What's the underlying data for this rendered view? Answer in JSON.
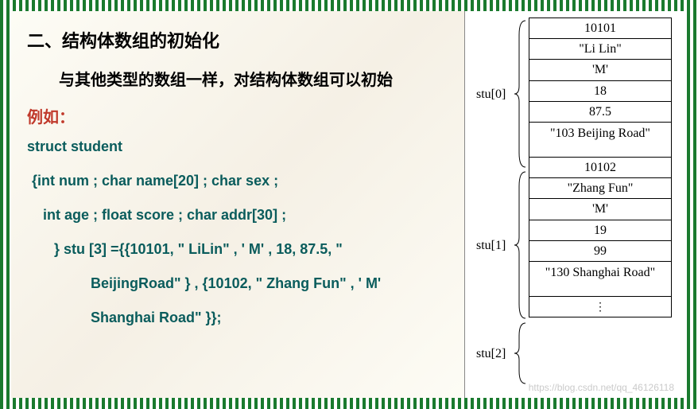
{
  "heading": "二、结构体数组的初始化",
  "body_text": "与其他类型的数组一样，对结构体数组可以初始",
  "example_label": "例如：",
  "code": {
    "line1": "struct student",
    "line2": "{int num ;  char name[20] ;  char sex ;",
    "line3": "int age ;  float score  ;  char addr[30] ;",
    "line4": "} stu [3]  ={{10101, \" LiLin\" , ' M' , 18, 87.5, \"",
    "line5": "BeijingRoad\" } ,  {10102, \" Zhang Fun\" , ' M'",
    "line6": "Shanghai Road\" }};"
  },
  "diagram": {
    "stu0": {
      "label": "stu[0]",
      "cells": [
        "10101",
        "\"Li Lin\"",
        "'M'",
        "18",
        "87.5",
        "\"103 Beijing Road\""
      ]
    },
    "stu1": {
      "label": "stu[1]",
      "cells": [
        "10102",
        "\"Zhang Fun\"",
        "'M'",
        "19",
        "99",
        "\"130 Shanghai Road\""
      ]
    },
    "stu2": {
      "label": "stu[2]",
      "cells": [
        "⋮"
      ]
    }
  },
  "watermark": "https://blog.csdn.net/qq_46126118"
}
